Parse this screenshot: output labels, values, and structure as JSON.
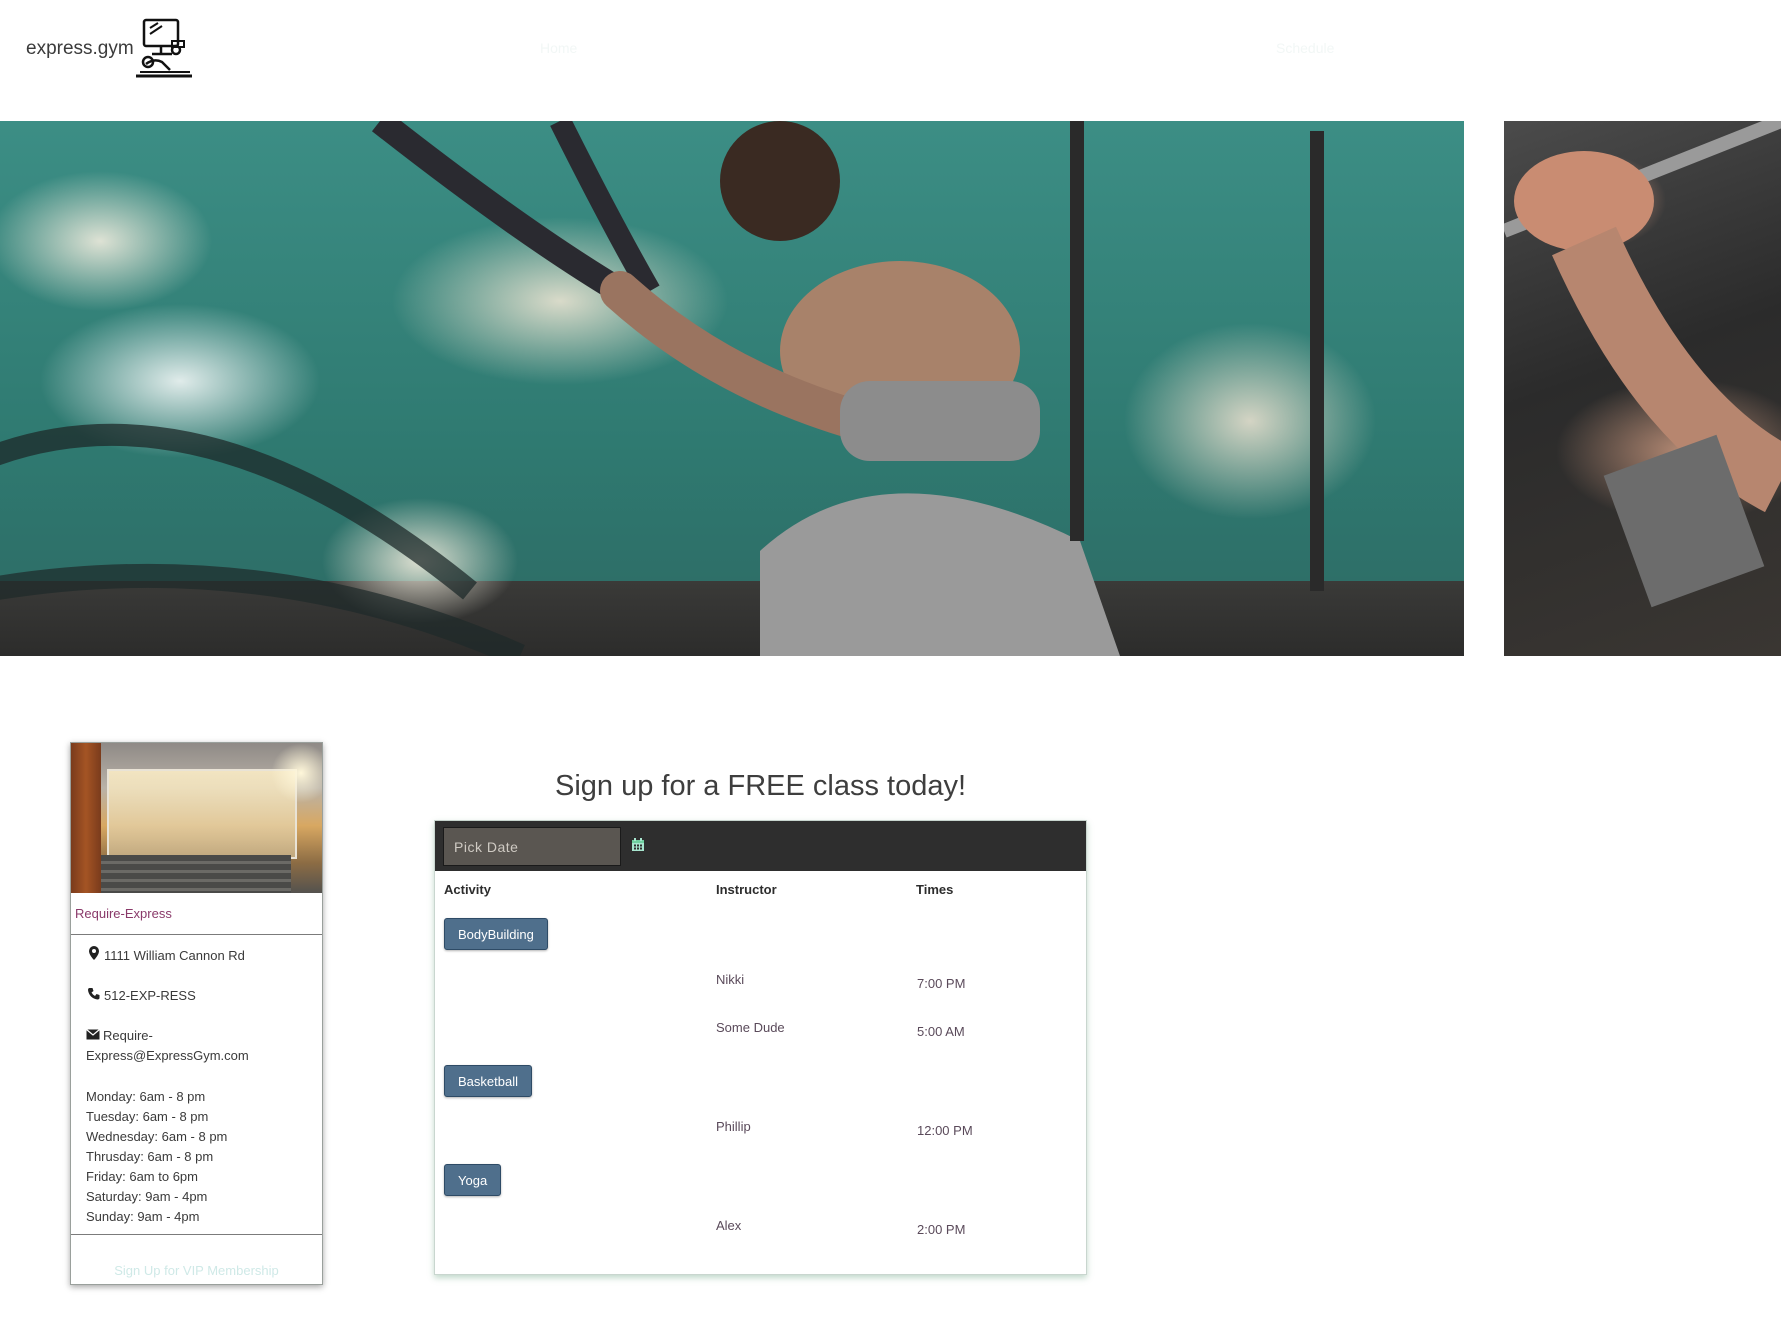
{
  "header": {
    "brand": "express.gym",
    "nav": [
      {
        "label": "Home"
      },
      {
        "label": "Schedule"
      }
    ]
  },
  "location_card": {
    "title": "Require-Express",
    "address": "1111 William Cannon Rd",
    "phone": "512-EXP-RESS",
    "email_line1": "Require-",
    "email_line2": "Express@ExpressGym.com",
    "hours": [
      "Monday: 6am - 8 pm",
      "Tuesday: 6am - 8 pm",
      "Wednesday: 6am - 8 pm",
      "Thrusday: 6am - 8 pm",
      "Friday: 6am to 6pm",
      "Saturday: 9am - 4pm",
      "Sunday: 9am - 4pm"
    ],
    "vip_link": "Sign Up for VIP Membership"
  },
  "schedule": {
    "title": "Sign up for a FREE class today!",
    "date_placeholder": "Pick Date",
    "columns": [
      "Activity",
      "Instructor",
      "Times"
    ],
    "activities": [
      {
        "name": "BodyBuilding",
        "sessions": [
          {
            "instructor": "Nikki",
            "time": "7:00 PM"
          },
          {
            "instructor": "Some Dude",
            "time": "5:00 AM"
          }
        ]
      },
      {
        "name": "Basketball",
        "sessions": [
          {
            "instructor": "Phillip",
            "time": "12:00 PM"
          }
        ]
      },
      {
        "name": "Yoga",
        "sessions": [
          {
            "instructor": "Alex",
            "time": "2:00 PM"
          }
        ]
      }
    ]
  },
  "colors": {
    "button_bg": "#4f6f8c",
    "bar_bg": "#2e2e2e",
    "accent_text": "#8a3a6a"
  }
}
